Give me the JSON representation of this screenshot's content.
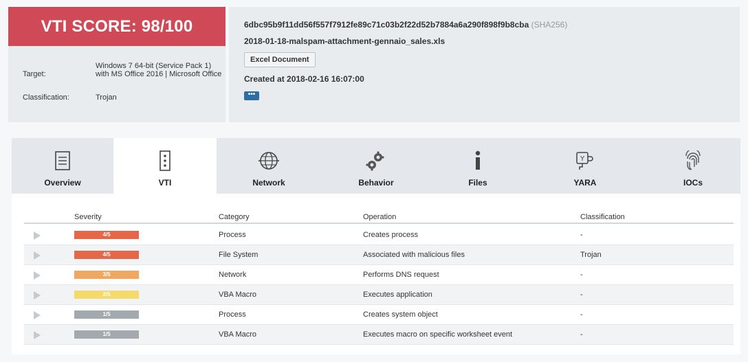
{
  "score": {
    "text": "VTI SCORE: 98/100",
    "color": "#cf4a56"
  },
  "meta": {
    "target_label": "Target:",
    "target_value": "Windows 7 64-bit (Service Pack 1) with MS Office 2016 | Microsoft Office",
    "classification_label": "Classification:",
    "classification_value": "Trojan"
  },
  "file": {
    "hash": "6dbc95b9f11dd56f557f7912fe89c71c03b2f22d52b7884a6a290f898f9b8cba",
    "hash_type": "(SHA256)",
    "name": "2018-01-18-malspam-attachment-gennaio_sales.xls",
    "type": "Excel Document",
    "created": "Created at 2018-02-16 16:07:00",
    "more": "•••"
  },
  "tabs": [
    {
      "label": "Overview",
      "icon": "document-icon"
    },
    {
      "label": "VTI",
      "icon": "server-icon",
      "active": true
    },
    {
      "label": "Network",
      "icon": "globe-icon"
    },
    {
      "label": "Behavior",
      "icon": "gears-icon"
    },
    {
      "label": "Files",
      "icon": "info-icon"
    },
    {
      "label": "YARA",
      "icon": "yara-icon"
    },
    {
      "label": "IOCs",
      "icon": "fingerprint-icon"
    }
  ],
  "table": {
    "headers": {
      "severity": "Severity",
      "category": "Category",
      "operation": "Operation",
      "classification": "Classification"
    },
    "rows": [
      {
        "severity": "4/5",
        "color": "#e5674a",
        "category": "Process",
        "operation": "Creates process",
        "classification": "-"
      },
      {
        "severity": "4/5",
        "color": "#e5674a",
        "category": "File System",
        "operation": "Associated with malicious files",
        "classification": "Trojan"
      },
      {
        "severity": "3/5",
        "color": "#f0a860",
        "category": "Network",
        "operation": "Performs DNS request",
        "classification": "-"
      },
      {
        "severity": "2/5",
        "color": "#f6d96b",
        "category": "VBA Macro",
        "operation": "Executes application",
        "classification": "-"
      },
      {
        "severity": "1/5",
        "color": "#a3a9ad",
        "category": "Process",
        "operation": "Creates system object",
        "classification": "-"
      },
      {
        "severity": "1/5",
        "color": "#a3a9ad",
        "category": "VBA Macro",
        "operation": "Executes macro on specific worksheet event",
        "classification": "-"
      }
    ]
  }
}
